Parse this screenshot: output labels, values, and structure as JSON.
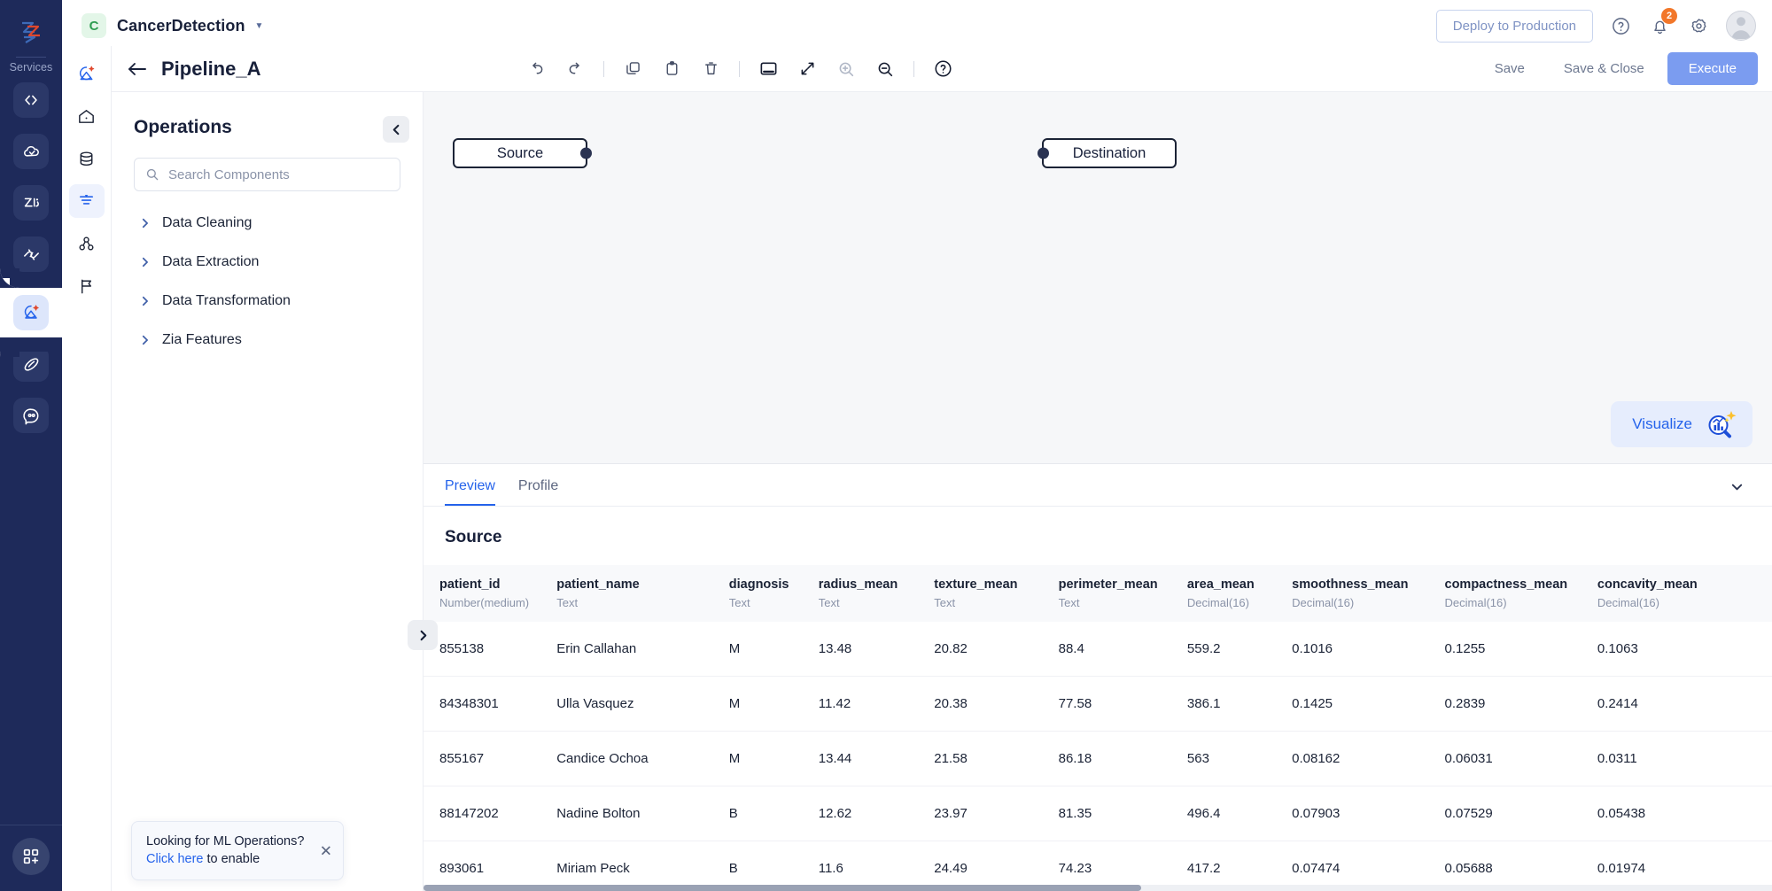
{
  "rail": {
    "logo_icon": "zoho-logo-icon",
    "services_label": "Services",
    "items": [
      {
        "name": "code-service",
        "icon": "code-brackets-icon"
      },
      {
        "name": "cloud-service",
        "icon": "cloud-icon"
      },
      {
        "name": "zia-service",
        "icon": "zia-icon"
      },
      {
        "name": "connections-service",
        "icon": "link-chain-icon"
      },
      {
        "name": "datalake-service",
        "icon": "satellite-dish-icon",
        "active": true
      },
      {
        "name": "orbit-service",
        "icon": "orbit-icon"
      },
      {
        "name": "chat-service",
        "icon": "chat-bubble-icon"
      }
    ],
    "apps_button": "apps-grid-add-icon"
  },
  "header": {
    "workspace_initial": "C",
    "workspace_name": "CancerDetection",
    "caret_icon": "chevron-down-icon",
    "deploy_label": "Deploy to Production",
    "help_icon": "question-circle-icon",
    "notification_icon": "bell-icon",
    "notification_count": "2",
    "settings_icon": "gear-icon",
    "avatar_icon": "user-avatar-icon"
  },
  "module_rail": {
    "items": [
      {
        "name": "module-zia",
        "icon": "satellite-dish-icon"
      },
      {
        "name": "module-home",
        "icon": "home-icon"
      },
      {
        "name": "module-database",
        "icon": "database-icon"
      },
      {
        "name": "module-pipelines",
        "icon": "funnel-icon",
        "active": true
      },
      {
        "name": "module-users",
        "icon": "people-group-icon"
      },
      {
        "name": "module-flags",
        "icon": "flag-icon"
      }
    ]
  },
  "pipeline": {
    "back_icon": "arrow-left-icon",
    "title": "Pipeline_A",
    "toolbar": [
      {
        "name": "undo-button",
        "icon": "undo-arrow-icon",
        "dim": false
      },
      {
        "name": "redo-button",
        "icon": "redo-arrow-icon",
        "dim": false
      },
      {
        "name": "divider-1",
        "icon": "divider"
      },
      {
        "name": "copy-button",
        "icon": "copy-icon",
        "dim": false
      },
      {
        "name": "paste-button",
        "icon": "clipboard-icon",
        "dim": false
      },
      {
        "name": "delete-button",
        "icon": "trash-icon",
        "dim": false
      },
      {
        "name": "divider-2",
        "icon": "divider"
      },
      {
        "name": "panel-toggle-button",
        "icon": "panel-bottom-icon",
        "dim": false
      },
      {
        "name": "fit-screen-button",
        "icon": "expand-diagonal-icon",
        "dim": false
      },
      {
        "name": "zoom-in-button",
        "icon": "magnifier-plus-icon",
        "dim": true
      },
      {
        "name": "zoom-out-button",
        "icon": "magnifier-minus-icon",
        "dim": false
      },
      {
        "name": "divider-3",
        "icon": "divider"
      },
      {
        "name": "help-button",
        "icon": "question-circle-icon",
        "dim": false
      }
    ],
    "save_label": "Save",
    "save_close_label": "Save & Close",
    "execute_label": "Execute"
  },
  "operations": {
    "title": "Operations",
    "collapse_icon": "chevron-left-icon",
    "search_icon": "search-icon",
    "search_placeholder": "Search Components",
    "search_value": "",
    "groups": [
      {
        "label": "Data Cleaning",
        "icon": "chevron-right-icon"
      },
      {
        "label": "Data Extraction",
        "icon": "chevron-right-icon"
      },
      {
        "label": "Data Transformation",
        "icon": "chevron-right-icon"
      },
      {
        "label": "Zia Features",
        "icon": "chevron-right-icon"
      }
    ],
    "expand_handle_icon": "chevron-right-icon",
    "add_node_icon": "plus-icon"
  },
  "toast": {
    "line1": "Looking for ML Operations?",
    "link_text": "Click here",
    "line2_rest": " to enable",
    "close_icon": "close-x-icon"
  },
  "canvas": {
    "nodes": [
      {
        "name": "source-node",
        "label": "Source",
        "port": "output-port"
      },
      {
        "name": "destination-node",
        "label": "Destination",
        "port": "input-port"
      }
    ],
    "visualize_label": "Visualize",
    "visualize_icon": "chart-magnifier-sparkle-icon"
  },
  "preview": {
    "tabs": [
      {
        "label": "Preview",
        "active": true
      },
      {
        "label": "Profile",
        "active": false
      }
    ],
    "collapse_icon": "chevron-down-icon",
    "source_title": "Source",
    "columns": [
      {
        "name": "patient_id",
        "type": "Number(medium)"
      },
      {
        "name": "patient_name",
        "type": "Text"
      },
      {
        "name": "diagnosis",
        "type": "Text"
      },
      {
        "name": "radius_mean",
        "type": "Text"
      },
      {
        "name": "texture_mean",
        "type": "Text"
      },
      {
        "name": "perimeter_mean",
        "type": "Text"
      },
      {
        "name": "area_mean",
        "type": "Decimal(16)"
      },
      {
        "name": "smoothness_mean",
        "type": "Decimal(16)"
      },
      {
        "name": "compactness_mean",
        "type": "Decimal(16)"
      },
      {
        "name": "concavity_mean",
        "type": "Decimal(16)"
      }
    ],
    "rows": [
      [
        "855138",
        "Erin Callahan",
        "M",
        "13.48",
        "20.82",
        "88.4",
        "559.2",
        "0.1016",
        "0.1255",
        "0.1063"
      ],
      [
        "84348301",
        "Ulla Vasquez",
        "M",
        "11.42",
        "20.38",
        "77.58",
        "386.1",
        "0.1425",
        "0.2839",
        "0.2414"
      ],
      [
        "855167",
        "Candice Ochoa",
        "M",
        "13.44",
        "21.58",
        "86.18",
        "563",
        "0.08162",
        "0.06031",
        "0.0311"
      ],
      [
        "88147202",
        "Nadine Bolton",
        "B",
        "12.62",
        "23.97",
        "81.35",
        "496.4",
        "0.07903",
        "0.07529",
        "0.05438"
      ],
      [
        "893061",
        "Miriam Peck",
        "B",
        "11.6",
        "24.49",
        "74.23",
        "417.2",
        "0.07474",
        "0.05688",
        "0.01974"
      ]
    ]
  },
  "colors": {
    "brand_navy": "#1e2a5a",
    "accent_blue": "#2563eb",
    "execute_blue": "#7b9cf0",
    "badge_orange": "#f2772a",
    "chip_green": "#2f9e52"
  }
}
